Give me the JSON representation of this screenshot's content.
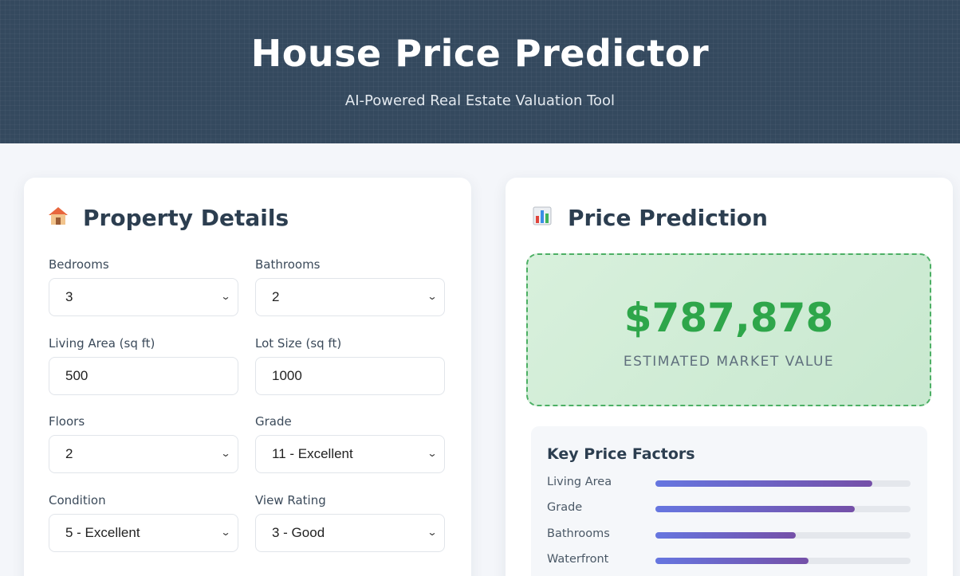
{
  "header": {
    "title": "House Price Predictor",
    "subtitle": "AI-Powered Real Estate Valuation Tool"
  },
  "property": {
    "icon": "house-icon",
    "title": "Property Details",
    "fields": [
      {
        "label": "Bedrooms",
        "value": "3",
        "type": "select"
      },
      {
        "label": "Bathrooms",
        "value": "2",
        "type": "select"
      },
      {
        "label": "Living Area (sq ft)",
        "value": "500",
        "type": "input"
      },
      {
        "label": "Lot Size (sq ft)",
        "value": "1000",
        "type": "input"
      },
      {
        "label": "Floors",
        "value": "2",
        "type": "select"
      },
      {
        "label": "Grade",
        "value": "11 - Excellent",
        "type": "select"
      },
      {
        "label": "Condition",
        "value": "5 - Excellent",
        "type": "select"
      },
      {
        "label": "View Rating",
        "value": "3 - Good",
        "type": "select"
      }
    ]
  },
  "prediction": {
    "icon": "bar-chart-icon",
    "title": "Price Prediction",
    "value": "$787,878",
    "caption": "ESTIMATED MARKET VALUE"
  },
  "factors": {
    "title": "Key Price Factors",
    "items": [
      {
        "name": "Living Area",
        "level": 0.85
      },
      {
        "name": "Grade",
        "level": 0.78
      },
      {
        "name": "Bathrooms",
        "level": 0.55
      },
      {
        "name": "Waterfront",
        "level": 0.6
      }
    ]
  },
  "colors": {
    "header_bg": "#34495e",
    "accent_green": "#2ea64a",
    "bar_start": "#6676e0",
    "bar_end": "#7550a8"
  }
}
